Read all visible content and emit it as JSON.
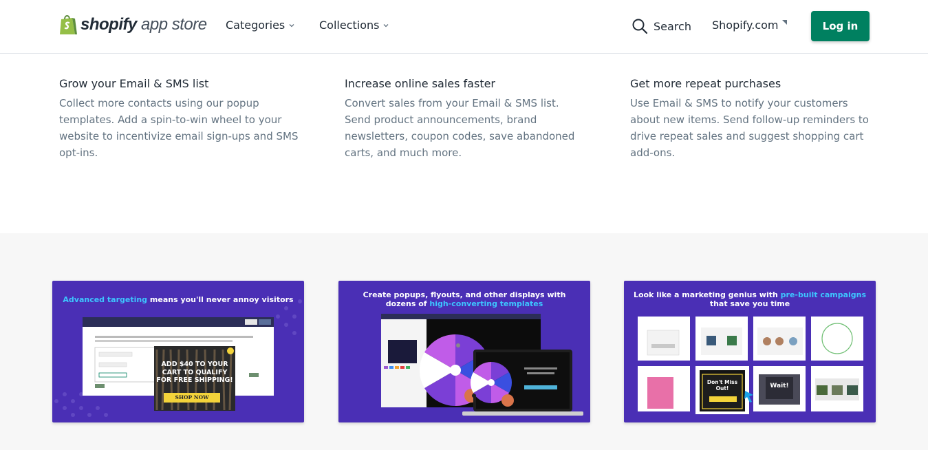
{
  "header": {
    "logo": {
      "bold": "shopify",
      "light": "app store"
    },
    "nav": [
      {
        "label": "Categories"
      },
      {
        "label": "Collections"
      }
    ],
    "search_label": "Search",
    "shopify_link": "Shopify.com",
    "login_label": "Log in"
  },
  "features": [
    {
      "title": "Grow your Email & SMS list",
      "desc": "Collect more contacts using our popup templates. Add a spin-to-win wheel to your website to incentivize email sign-ups and SMS opt-ins."
    },
    {
      "title": "Increase online sales faster",
      "desc": "Convert sales from your Email & SMS list. Send product announcements, brand newsletters, coupon codes, save abandoned carts, and much more."
    },
    {
      "title": "Get more repeat purchases",
      "desc": "Use Email & SMS to notify your customers about new items. Send follow-up reminders to drive repeat sales and suggest shopping cart add-ons."
    }
  ],
  "screenshots": [
    {
      "title_hl": "Advanced targeting",
      "title_rest": " means you'll never annoy visitors",
      "popup_text": "ADD $40 TO YOUR CART TO QUALIFY FOR FREE SHIPPING!",
      "popup_button": "SHOP NOW"
    },
    {
      "title_line1": "Create popups, flyouts, and other displays with",
      "title_line2_plain": "dozens of ",
      "title_line2_hl": "high-converting templates"
    },
    {
      "title_plain1": "Look like a marketing genius with ",
      "title_hl": "pre-built campaigns",
      "title_plain2": " that save you time",
      "tile_popup": "Don't Miss Out!",
      "tile_wait": "Wait!"
    }
  ],
  "colors": {
    "brand_green": "#008060",
    "card_purple": "#4a2fb5",
    "highlight_cyan": "#3dc6ff"
  }
}
